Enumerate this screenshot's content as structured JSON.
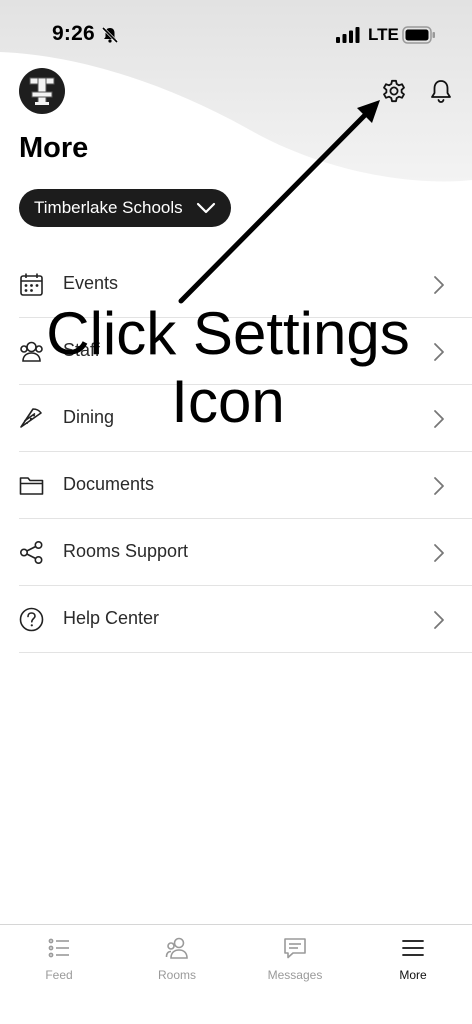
{
  "status_bar": {
    "time": "9:26",
    "network": "LTE"
  },
  "header": {
    "title": "More",
    "school_selector": "Timberlake Schools",
    "icons": [
      "logo",
      "settings-icon",
      "bell-icon"
    ]
  },
  "menu": {
    "items": [
      {
        "label": "Events",
        "icon": "calendar-icon"
      },
      {
        "label": "Staff",
        "icon": "people-icon"
      },
      {
        "label": "Dining",
        "icon": "pizza-icon"
      },
      {
        "label": "Documents",
        "icon": "folder-icon"
      },
      {
        "label": "Rooms Support",
        "icon": "share-icon"
      },
      {
        "label": "Help Center",
        "icon": "help-icon"
      }
    ]
  },
  "annotation": {
    "line1": "Click Settings",
    "line2": "Icon"
  },
  "tab_bar": {
    "tabs": [
      {
        "label": "Feed",
        "icon": "feed-icon"
      },
      {
        "label": "Rooms",
        "icon": "rooms-icon"
      },
      {
        "label": "Messages",
        "icon": "messages-icon"
      },
      {
        "label": "More",
        "icon": "menu-icon"
      }
    ],
    "active": "More"
  },
  "colors": {
    "header_gradient_top": "#dcdcdc",
    "pill_bg": "#1c1c1c",
    "divider": "#e3e3e3",
    "inactive_tab": "#9a9a9a"
  }
}
